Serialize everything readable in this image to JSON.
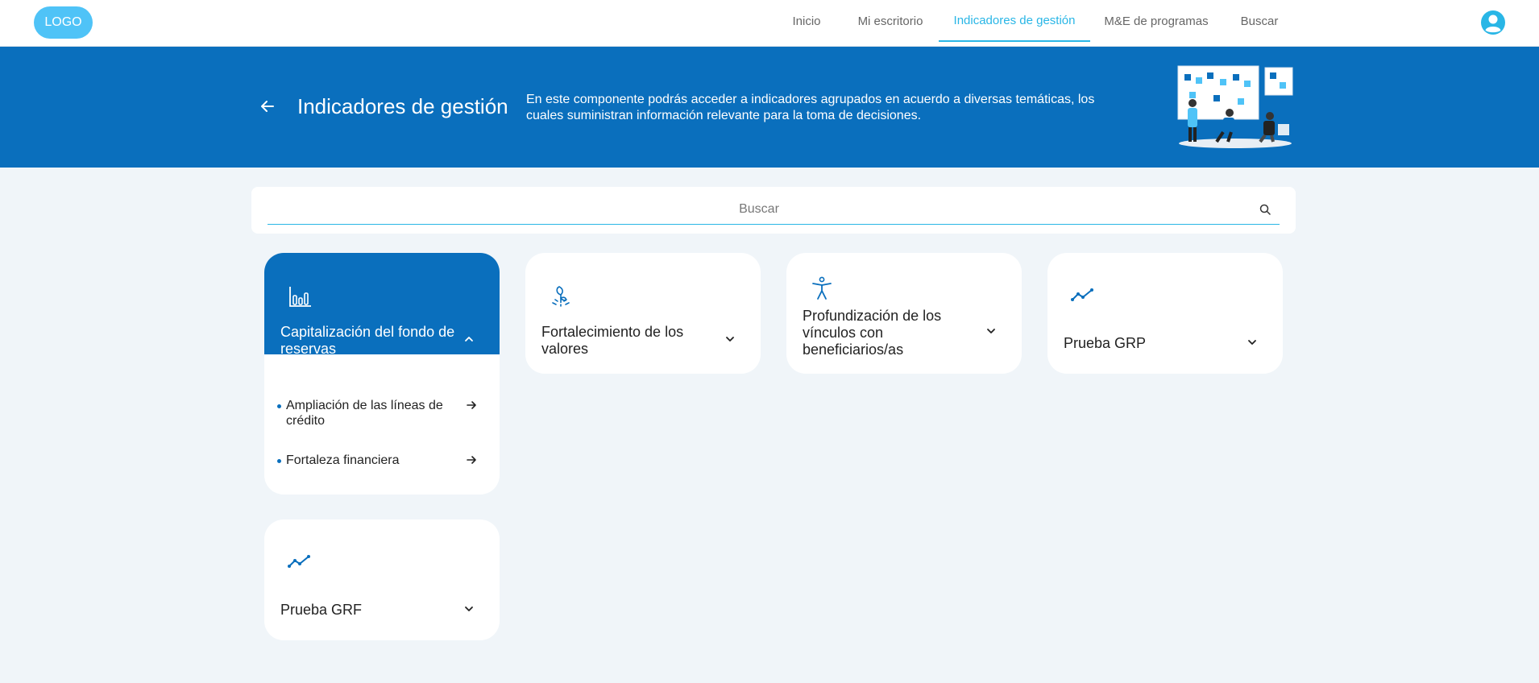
{
  "header": {
    "logo": "LOGO",
    "nav": [
      {
        "label": "Inicio",
        "active": false
      },
      {
        "label": "Mi escritorio",
        "active": false
      },
      {
        "label": "Indicadores de gestión",
        "active": true
      },
      {
        "label": "M&E de programas",
        "active": false
      },
      {
        "label": "Buscar",
        "active": false
      }
    ],
    "avatar_icon": "user-avatar-icon"
  },
  "banner": {
    "title": "Indicadores de gestión",
    "description": "En este componente podrás acceder a indicadores agrupados en acuerdo a diversas temáticas, los cuales suministran información relevante para la toma de decisiones.",
    "back_icon": "arrow-left-icon"
  },
  "search": {
    "placeholder": "Buscar",
    "value": "",
    "icon": "search-icon"
  },
  "cards": [
    {
      "title": "Capitalización del fondo de reservas",
      "icon": "bar-chart-icon",
      "expanded": true
    },
    {
      "title": "Fortalecimiento de los valores",
      "icon": "sprout-icon",
      "expanded": false
    },
    {
      "title": "Profundización de los vínculos con beneficiarios/as",
      "icon": "accessibility-icon",
      "expanded": false
    },
    {
      "title": "Prueba GRP",
      "icon": "trend-line-icon",
      "expanded": false
    },
    {
      "title": "Prueba GRF",
      "icon": "trend-line-icon",
      "expanded": false
    }
  ],
  "expanded_items": [
    {
      "label": "Ampliación de las líneas de crédito"
    },
    {
      "label": "Fortaleza financiera"
    }
  ],
  "colors": {
    "primary": "#0a6fbd",
    "accent": "#29b6e6",
    "logo": "#4fc3f7",
    "background": "#f0f5f9"
  }
}
